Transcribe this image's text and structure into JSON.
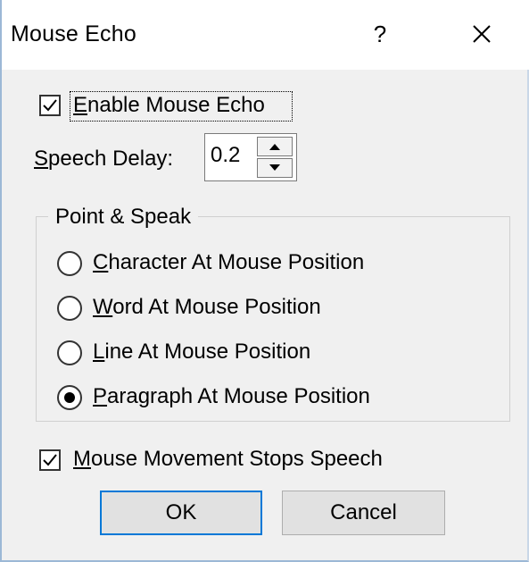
{
  "window": {
    "title": "Mouse Echo",
    "help_glyph": "?",
    "close_icon": "close-icon"
  },
  "enable_echo": {
    "accel": "E",
    "rest": "nable Mouse Echo",
    "checked": true
  },
  "speech_delay": {
    "accel": "S",
    "rest": "peech Delay:",
    "value": "0.2"
  },
  "point_and_speak": {
    "legend": "Point & Speak",
    "options": [
      {
        "accel": "C",
        "rest": "haracter At Mouse Position",
        "selected": false
      },
      {
        "accel": "W",
        "rest": "ord At Mouse Position",
        "selected": false
      },
      {
        "accel": "L",
        "rest": "ine At Mouse Position",
        "selected": false
      },
      {
        "accel": "P",
        "rest": "aragraph At Mouse Position",
        "selected": true
      }
    ]
  },
  "movement_stops": {
    "accel": "M",
    "rest": "ouse Movement Stops Speech",
    "checked": true
  },
  "buttons": {
    "ok": "OK",
    "cancel": "Cancel"
  },
  "colors": {
    "accent": "#0078d7",
    "dialog_bg": "#f0f0f0",
    "titlebar_bg": "#ffffff"
  }
}
